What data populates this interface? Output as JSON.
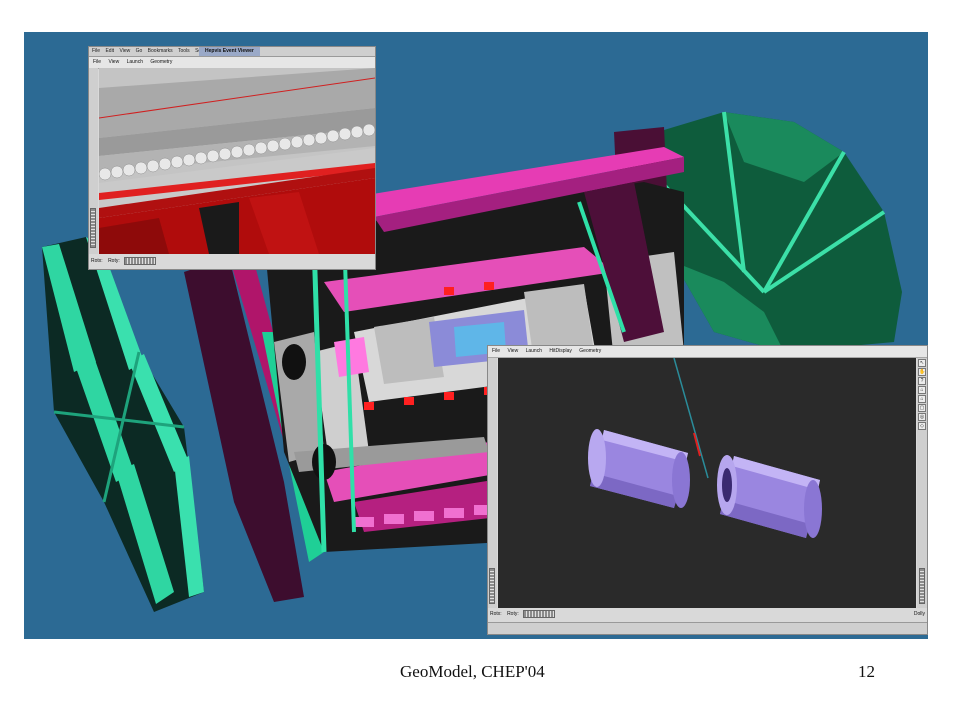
{
  "slide": {
    "footer_title": "GeoModel, CHEP'04",
    "page_number": "12"
  },
  "scene": {
    "background_color": "#2c6a94",
    "description_icon": "atlas-detector-3d-render"
  },
  "viewer_top": {
    "title_menus": [
      "File",
      "Edit",
      "View",
      "Go",
      "Bookmarks",
      "Tools",
      "Settings"
    ],
    "window_title": "Hepvis Event Viewer",
    "menus": [
      "File",
      "View",
      "Launch",
      "Geometry"
    ],
    "rot_x_label": "Rotx:",
    "rot_y_label": "Roty:"
  },
  "viewer_bottom": {
    "menus": [
      "File",
      "View",
      "Launch",
      "HitDisplay",
      "Geometry"
    ],
    "rot_x_label": "Rotx:",
    "rot_y_label": "Roty:",
    "dolly_label": "Dolly",
    "toolbar_icons": [
      "arrow-icon",
      "hand-icon",
      "help-icon",
      "home-icon",
      "set-home-icon",
      "view-all-icon",
      "seek-icon",
      "perspective-icon"
    ],
    "view_background": "#2a2a2a"
  }
}
